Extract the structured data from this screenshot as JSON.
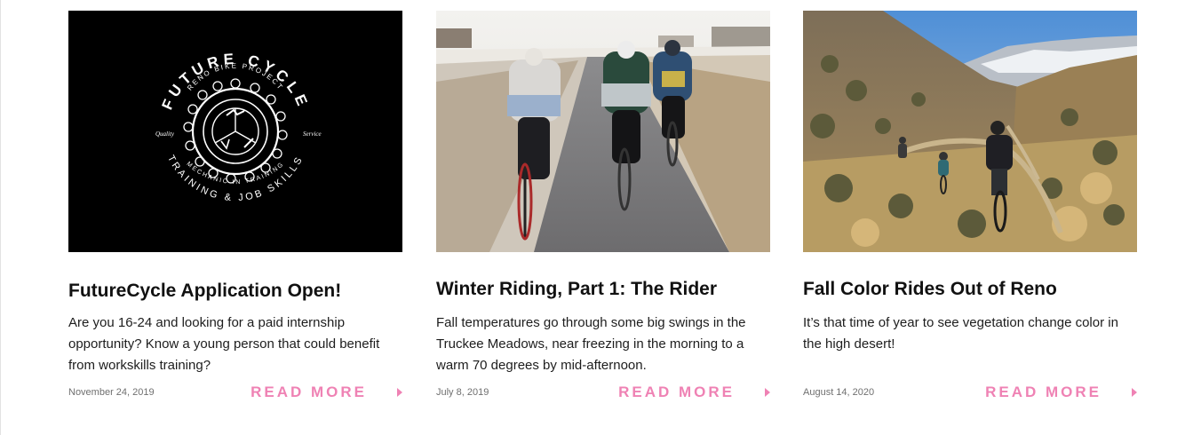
{
  "posts": [
    {
      "title": "FutureCycle Application Open!",
      "excerpt": "Are you 16-24 and looking for a paid internship opportunity? Know a young person that could benefit from workskills training?",
      "date": "November 24, 2019",
      "read_more_label": "READ MORE",
      "logo": {
        "top_text": "RENO BIKE PROJECT",
        "title_text": "FUTURE CYCLE",
        "left_script": "Quality",
        "right_script": "Service",
        "bottom_text": "TRAINING & JOB SKILLS",
        "footer_text": "MECHANIC IN TRAINING"
      }
    },
    {
      "title": "Winter Riding, Part 1: The Rider",
      "excerpt": "Fall temperatures go through some big swings in the Truckee Meadows, near freezing in the morning to a warm 70 degrees by mid-afternoon.",
      "date": "July 8, 2019",
      "read_more_label": "READ MORE"
    },
    {
      "title": "Fall Color Rides Out of Reno",
      "excerpt": "It’s that time of year to see vegetation change color in the high desert!",
      "date": "August 14, 2020",
      "read_more_label": "READ MORE"
    }
  ],
  "colors": {
    "accent": "#ef82b4",
    "title": "#111111",
    "body_text": "#1d1d1d",
    "date_text": "#6f6f6f"
  }
}
